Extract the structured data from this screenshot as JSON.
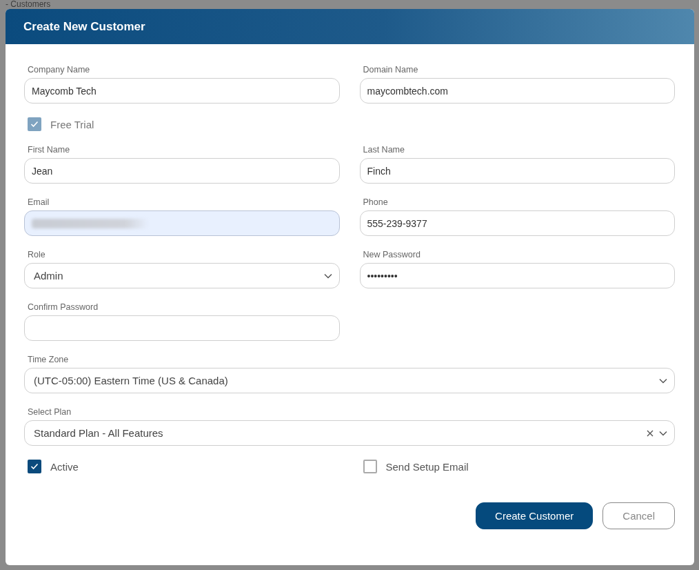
{
  "background": {
    "page_title": "- Customers"
  },
  "dialog": {
    "title": "Create New Customer",
    "rows": [
      [
        {
          "kind": "text",
          "label": "Company Name",
          "value": "Maycomb Tech"
        },
        {
          "kind": "text",
          "label": "Domain Name",
          "value": "maycombtech.com"
        }
      ],
      [
        {
          "kind": "checkbox",
          "label": "Free Trial",
          "checked": true,
          "disabled": true
        }
      ],
      [
        {
          "kind": "text",
          "label": "First Name",
          "value": "Jean"
        },
        {
          "kind": "text",
          "label": "Last Name",
          "value": "Finch"
        }
      ],
      [
        {
          "kind": "redacted",
          "label": "Email",
          "autofilled": true
        },
        {
          "kind": "text",
          "label": "Phone",
          "value": "555-239-9377"
        }
      ],
      [
        {
          "kind": "select",
          "label": "Role",
          "value": "Admin"
        },
        {
          "kind": "text",
          "label": "New Password",
          "value": "•••••••••"
        }
      ],
      [
        {
          "kind": "text",
          "label": "Confirm Password"
        }
      ],
      [
        {
          "kind": "select",
          "label": "Time Zone",
          "value": "(UTC-05:00) Eastern Time (US & Canada)",
          "full_width": true
        }
      ],
      [
        {
          "kind": "select",
          "label": "Select Plan",
          "value": "Standard Plan - All Features",
          "full_width": true,
          "clearable": true
        }
      ],
      [
        {
          "kind": "checkbox",
          "label": "Active",
          "checked": true,
          "disabled": false
        },
        {
          "kind": "checkbox",
          "label": "Send Setup Email",
          "checked": false,
          "disabled": false
        }
      ]
    ],
    "buttons": [
      {
        "kind": "primary",
        "label": "Create Customer"
      },
      {
        "kind": "secondary",
        "label": "Cancel"
      }
    ]
  }
}
